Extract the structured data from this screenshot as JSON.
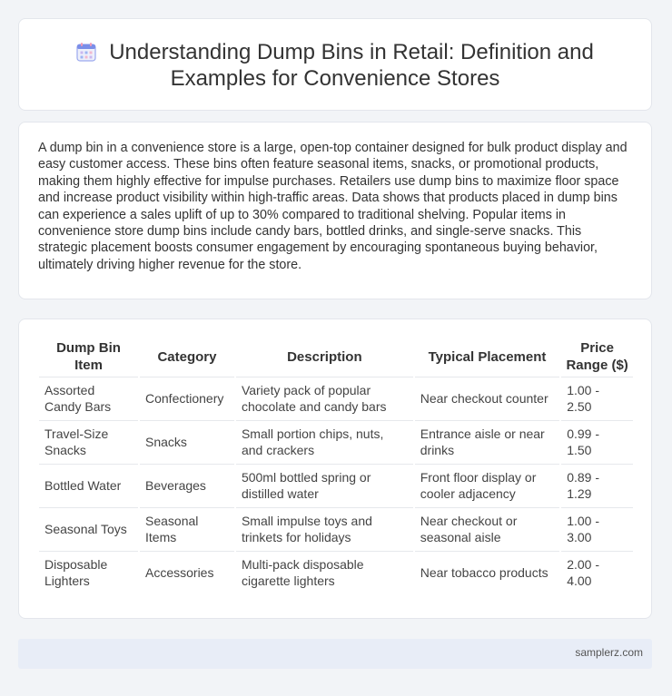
{
  "header": {
    "title_line1": "Understanding Dump Bins in Retail: Definition and",
    "title_line2": "Examples for Convenience Stores",
    "icon": "calendar-icon",
    "icon_color": "#7b8ee8"
  },
  "intro": {
    "text": "A dump bin in a convenience store is a large, open-top container designed for bulk product display and easy customer access. These bins often feature seasonal items, snacks, or promotional products, making them highly effective for impulse purchases. Retailers use dump bins to maximize floor space and increase product visibility within high-traffic areas. Data shows that products placed in dump bins can experience a sales uplift of up to 30% compared to traditional shelving. Popular items in convenience store dump bins include candy bars, bottled drinks, and single-serve snacks. This strategic placement boosts consumer engagement by encouraging spontaneous buying behavior, ultimately driving higher revenue for the store."
  },
  "table": {
    "headers": [
      "Dump Bin Item",
      "Category",
      "Description",
      "Typical Placement",
      "Price Range ($)"
    ],
    "rows": [
      [
        "Assorted Candy Bars",
        "Confectionery",
        "Variety pack of popular chocolate and candy bars",
        "Near checkout counter",
        "1.00 - 2.50"
      ],
      [
        "Travel-Size Snacks",
        "Snacks",
        "Small portion chips, nuts, and crackers",
        "Entrance aisle or near drinks",
        "0.99 - 1.50"
      ],
      [
        "Bottled Water",
        "Beverages",
        "500ml bottled spring or distilled water",
        "Front floor display or cooler adjacency",
        "0.89 - 1.29"
      ],
      [
        "Seasonal Toys",
        "Seasonal Items",
        "Small impulse toys and trinkets for holidays",
        "Near checkout or seasonal aisle",
        "1.00 - 3.00"
      ],
      [
        "Disposable Lighters",
        "Accessories",
        "Multi-pack disposable cigarette lighters",
        "Near tobacco products",
        "2.00 - 4.00"
      ]
    ]
  },
  "footer": {
    "site": "samplerz.com"
  }
}
